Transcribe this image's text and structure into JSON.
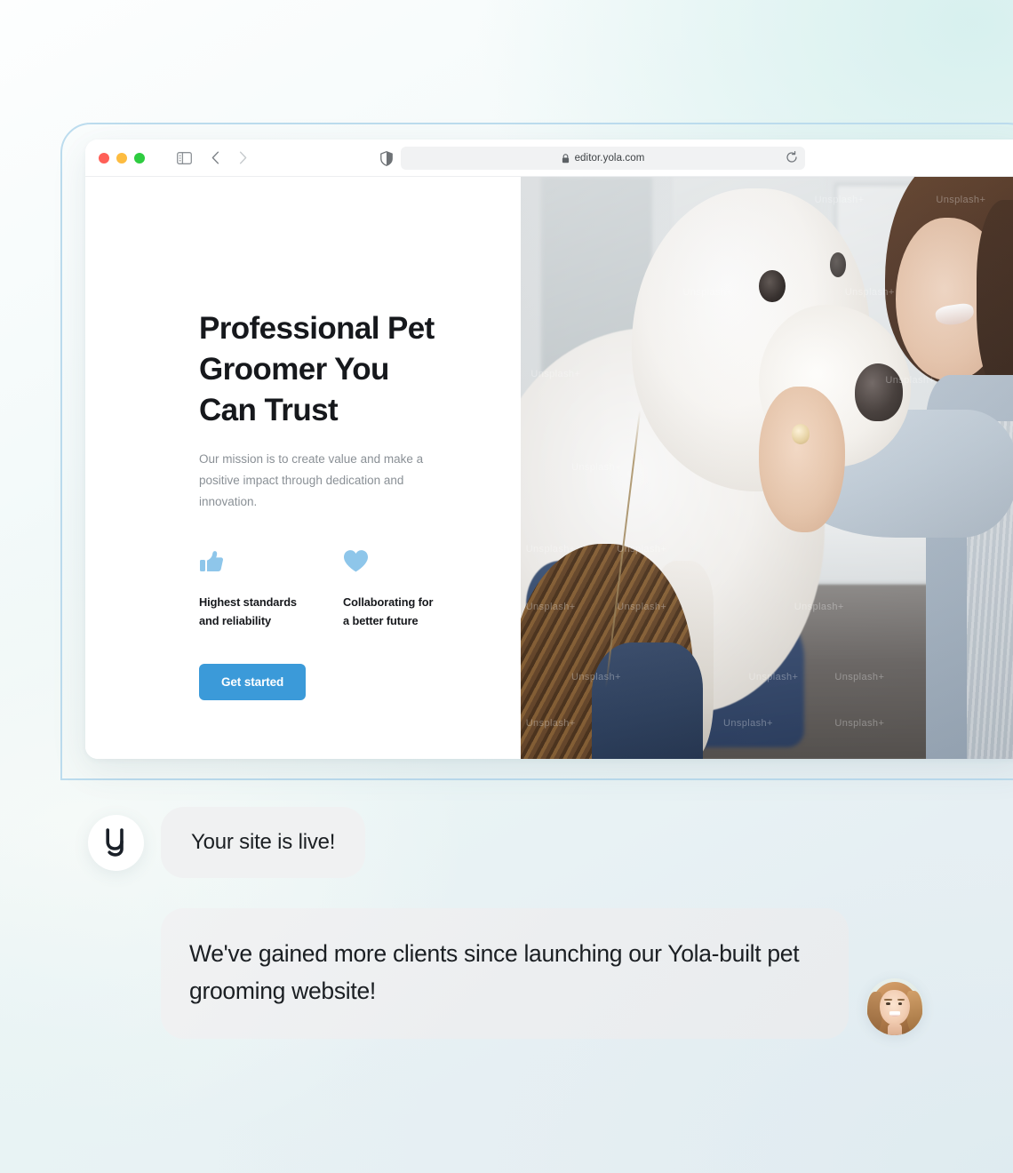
{
  "browser": {
    "traffic_lights": [
      "close",
      "minimize",
      "maximize"
    ],
    "url": "editor.yola.com",
    "lock_icon": "lock-icon",
    "reload_icon": "reload-icon",
    "sidebar_icon": "sidebar-toggle-icon",
    "back_icon": "chevron-left-icon",
    "forward_icon": "chevron-right-icon",
    "shield_icon": "shield-icon"
  },
  "hero": {
    "title": "Professional Pet\nGroomer You\nCan Trust",
    "subtitle": "Our mission is to create value and make a positive impact through dedication and innovation.",
    "features": [
      {
        "icon": "thumbs-up-icon",
        "label": "Highest standards\nand reliability"
      },
      {
        "icon": "heart-icon",
        "label": "Collaborating for\na better future"
      }
    ],
    "cta_label": "Get started",
    "image_alt": "woman grooming a large white dog in a pet salon",
    "image_watermark": "Unsplash+"
  },
  "chat": {
    "messages": [
      {
        "avatar": "yola-logo-avatar",
        "avatar_letter": "y",
        "text": "Your site is live!"
      },
      {
        "avatar": "user-photo-avatar",
        "text": "We've gained more clients since launching our Yola-built pet grooming website!"
      }
    ]
  },
  "colors": {
    "accent_blue": "#3b9ad9",
    "icon_blue": "#8ec6ea",
    "frame_blue": "#bcdcee",
    "bubble_gray": "#f0f1f2",
    "text_dark": "#16181c",
    "text_muted": "#8a9096"
  }
}
